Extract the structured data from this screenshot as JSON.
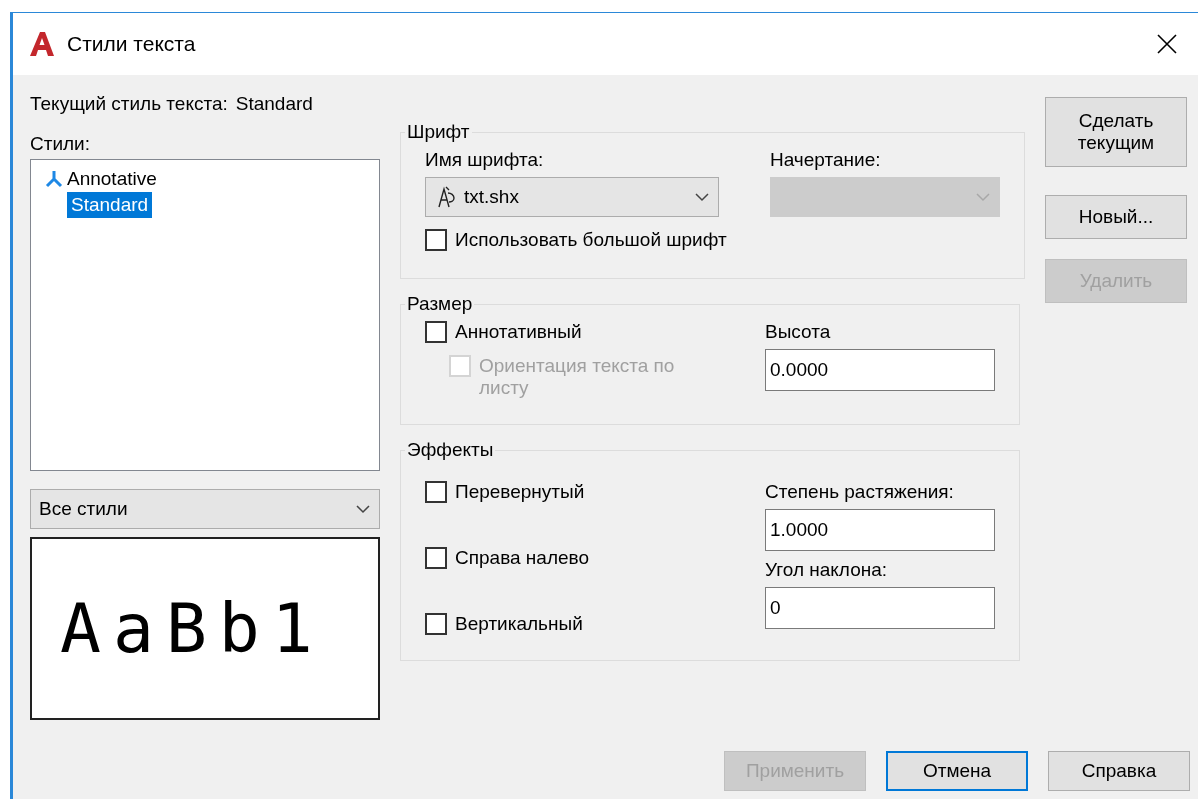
{
  "window": {
    "title": "Стили текста"
  },
  "current_style": {
    "label": "Текущий стиль текста:",
    "value": "Standard"
  },
  "styles": {
    "label": "Стили:",
    "items": [
      {
        "name": "Annotative",
        "kind": "annotative",
        "selected": false
      },
      {
        "name": "Standard",
        "kind": "plain",
        "selected": true
      }
    ]
  },
  "filter": {
    "value": "Все стили"
  },
  "preview": {
    "text": "AaBb1"
  },
  "font": {
    "title": "Шрифт",
    "font_name": {
      "label": "Имя шрифта:",
      "value": "txt.shx",
      "disabled": false
    },
    "font_style": {
      "label": "Начертание:",
      "disabled": true
    },
    "big_font": {
      "label": "Использовать большой шрифт",
      "checked": false,
      "disabled": false
    }
  },
  "size": {
    "title": "Размер",
    "annotative": {
      "label": "Аннотативный",
      "checked": false,
      "disabled": false
    },
    "orientation": {
      "label": "Ориентация текста по листу",
      "checked": false,
      "disabled": true
    },
    "height": {
      "label": "Высота",
      "value": "0.0000"
    }
  },
  "effects": {
    "title": "Эффекты",
    "checkboxes": [
      {
        "label": "Перевернутый",
        "checked": false,
        "disabled": false
      },
      {
        "label": "Справа налево",
        "checked": false,
        "disabled": false
      },
      {
        "label": "Вертикальный",
        "checked": false,
        "disabled": false
      }
    ],
    "fields": [
      {
        "label": "Степень растяжения:",
        "value": "1.0000"
      },
      {
        "label": "Угол наклона:",
        "value": "0"
      }
    ]
  },
  "side_buttons": [
    {
      "label": "Сделать текущим",
      "disabled": false,
      "focused": false
    },
    {
      "label": "Новый...",
      "disabled": false,
      "focused": false
    },
    {
      "label": "Удалить",
      "disabled": true,
      "focused": false
    }
  ],
  "bottom_buttons": [
    {
      "label": "Применить",
      "disabled": true,
      "focused": false
    },
    {
      "label": "Отмена",
      "disabled": false,
      "focused": true
    },
    {
      "label": "Справка",
      "disabled": false,
      "focused": false
    }
  ]
}
